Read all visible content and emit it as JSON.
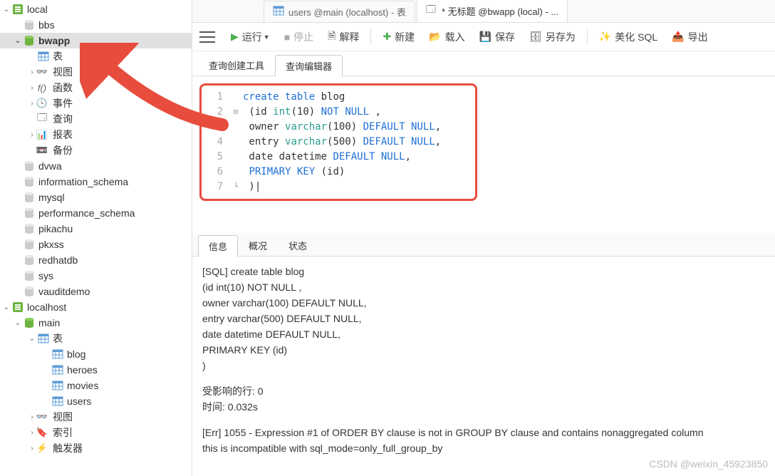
{
  "sidebar": {
    "nodes": [
      {
        "indent": 0,
        "caret": "down",
        "iconType": "conn",
        "label": "local",
        "selected": false,
        "id": "conn-local"
      },
      {
        "indent": 1,
        "caret": "none",
        "iconType": "db",
        "label": "bbs",
        "id": "db-bbs"
      },
      {
        "indent": 1,
        "caret": "down",
        "iconType": "db-active",
        "label": "bwapp",
        "selected": true,
        "id": "db-bwapp"
      },
      {
        "indent": 2,
        "caret": "none",
        "iconType": "table",
        "label": "表",
        "id": "tables-bwapp"
      },
      {
        "indent": 2,
        "caret": "right",
        "iconType": "view",
        "label": "视图",
        "id": "views-bwapp"
      },
      {
        "indent": 2,
        "caret": "right",
        "iconType": "fx",
        "label": "函数",
        "id": "functions-bwapp"
      },
      {
        "indent": 2,
        "caret": "right",
        "iconType": "event",
        "label": "事件",
        "id": "events-bwapp"
      },
      {
        "indent": 2,
        "caret": "none",
        "iconType": "query",
        "label": "查询",
        "id": "queries-bwapp"
      },
      {
        "indent": 2,
        "caret": "right",
        "iconType": "report",
        "label": "报表",
        "id": "reports-bwapp"
      },
      {
        "indent": 2,
        "caret": "none",
        "iconType": "backup",
        "label": "备份",
        "id": "backup-bwapp"
      },
      {
        "indent": 1,
        "caret": "none",
        "iconType": "db",
        "label": "dvwa",
        "id": "db-dvwa"
      },
      {
        "indent": 1,
        "caret": "none",
        "iconType": "db",
        "label": "information_schema",
        "id": "db-information_schema"
      },
      {
        "indent": 1,
        "caret": "none",
        "iconType": "db",
        "label": "mysql",
        "id": "db-mysql"
      },
      {
        "indent": 1,
        "caret": "none",
        "iconType": "db",
        "label": "performance_schema",
        "id": "db-performance_schema"
      },
      {
        "indent": 1,
        "caret": "none",
        "iconType": "db",
        "label": "pikachu",
        "id": "db-pikachu"
      },
      {
        "indent": 1,
        "caret": "none",
        "iconType": "db",
        "label": "pkxss",
        "id": "db-pkxss"
      },
      {
        "indent": 1,
        "caret": "none",
        "iconType": "db",
        "label": "redhatdb",
        "id": "db-redhatdb"
      },
      {
        "indent": 1,
        "caret": "none",
        "iconType": "db",
        "label": "sys",
        "id": "db-sys"
      },
      {
        "indent": 1,
        "caret": "none",
        "iconType": "db",
        "label": "vauditdemo",
        "id": "db-vauditdemo"
      },
      {
        "indent": 0,
        "caret": "down",
        "iconType": "conn",
        "label": "localhost",
        "id": "conn-localhost"
      },
      {
        "indent": 1,
        "caret": "down",
        "iconType": "db-active",
        "label": "main",
        "id": "db-main"
      },
      {
        "indent": 2,
        "caret": "down",
        "iconType": "table",
        "label": "表",
        "id": "tables-main"
      },
      {
        "indent": 3,
        "caret": "none",
        "iconType": "table",
        "label": "blog",
        "id": "table-blog"
      },
      {
        "indent": 3,
        "caret": "none",
        "iconType": "table",
        "label": "heroes",
        "id": "table-heroes"
      },
      {
        "indent": 3,
        "caret": "none",
        "iconType": "table",
        "label": "movies",
        "id": "table-movies"
      },
      {
        "indent": 3,
        "caret": "none",
        "iconType": "table",
        "label": "users",
        "id": "table-users"
      },
      {
        "indent": 2,
        "caret": "right",
        "iconType": "view",
        "label": "视图",
        "id": "views-main"
      },
      {
        "indent": 2,
        "caret": "right",
        "iconType": "index",
        "label": "索引",
        "id": "indexes-main"
      },
      {
        "indent": 2,
        "caret": "right",
        "iconType": "trigger",
        "label": "触发器",
        "id": "triggers-main"
      }
    ]
  },
  "object_tabs": [
    {
      "label": "users @main (localhost) - 表",
      "icon": "table",
      "modified": false,
      "active": false
    },
    {
      "label": "* 无标题 @bwapp (local) - ...",
      "icon": "query",
      "modified": true,
      "active": true
    }
  ],
  "toolbar": {
    "run": "运行",
    "stop": "停止",
    "explain": "解释",
    "new": "新建",
    "load": "载入",
    "save": "保存",
    "saveas": "另存为",
    "beautify": "美化 SQL",
    "export": "导出"
  },
  "subtabs": {
    "builder": "查询创建工具",
    "editor": "查询编辑器"
  },
  "editor_lines": [
    {
      "n": 1,
      "fold": "",
      "segs": [
        {
          "t": "create table",
          "c": "kw-blue"
        },
        {
          "t": " blog",
          "c": "c-black"
        }
      ]
    },
    {
      "n": 2,
      "fold": "minus",
      "segs": [
        {
          "t": " (",
          "c": "c-black"
        },
        {
          "t": "id ",
          "c": "c-black"
        },
        {
          "t": "int",
          "c": "kw-teal"
        },
        {
          "t": "(",
          "c": "c-black"
        },
        {
          "t": "10",
          "c": "c-black"
        },
        {
          "t": ") ",
          "c": "c-black"
        },
        {
          "t": "NOT NULL",
          "c": "kw-blue"
        },
        {
          "t": " ,",
          "c": "c-black"
        }
      ]
    },
    {
      "n": 3,
      "fold": "",
      "segs": [
        {
          "t": " owner ",
          "c": "c-black"
        },
        {
          "t": "varchar",
          "c": "kw-teal"
        },
        {
          "t": "(",
          "c": "c-black"
        },
        {
          "t": "100",
          "c": "c-black"
        },
        {
          "t": ") ",
          "c": "c-black"
        },
        {
          "t": "DEFAULT NULL",
          "c": "kw-blue"
        },
        {
          "t": ",",
          "c": "c-black"
        }
      ]
    },
    {
      "n": 4,
      "fold": "",
      "segs": [
        {
          "t": " entry ",
          "c": "c-black"
        },
        {
          "t": "varchar",
          "c": "kw-teal"
        },
        {
          "t": "(",
          "c": "c-black"
        },
        {
          "t": "500",
          "c": "c-black"
        },
        {
          "t": ") ",
          "c": "c-black"
        },
        {
          "t": "DEFAULT NULL",
          "c": "kw-blue"
        },
        {
          "t": ",",
          "c": "c-black"
        }
      ]
    },
    {
      "n": 5,
      "fold": "",
      "segs": [
        {
          "t": " date datetime ",
          "c": "c-black"
        },
        {
          "t": "DEFAULT NULL",
          "c": "kw-blue"
        },
        {
          "t": ",",
          "c": "c-black"
        }
      ]
    },
    {
      "n": 6,
      "fold": "",
      "segs": [
        {
          "t": " ",
          "c": "c-black"
        },
        {
          "t": "PRIMARY KEY",
          "c": "kw-blue"
        },
        {
          "t": " (id)",
          "c": "c-black"
        }
      ]
    },
    {
      "n": 7,
      "fold": "end",
      "segs": [
        {
          "t": " )",
          "c": "c-black"
        },
        {
          "t": "|",
          "c": "cursor-bar"
        }
      ]
    }
  ],
  "bottom_tabs": {
    "info": "信息",
    "summary": "概况",
    "status": "状态"
  },
  "output": {
    "sql_prefix": "[SQL]  create table blog",
    "l2": " (id int(10) NOT NULL ,",
    "l3": " owner varchar(100) DEFAULT NULL,",
    "l4": " entry varchar(500) DEFAULT NULL,",
    "l5": " date datetime DEFAULT NULL,",
    "l6": " PRIMARY KEY (id)",
    "l7": ")",
    "affected": "受影响的行: 0",
    "time": "时间: 0.032s",
    "err1": "[Err] 1055 - Expression #1 of ORDER BY clause is not in GROUP BY clause and contains nonaggregated column",
    "err2": "this is incompatible with sql_mode=only_full_group_by"
  },
  "watermark": "CSDN @weixin_45923850"
}
